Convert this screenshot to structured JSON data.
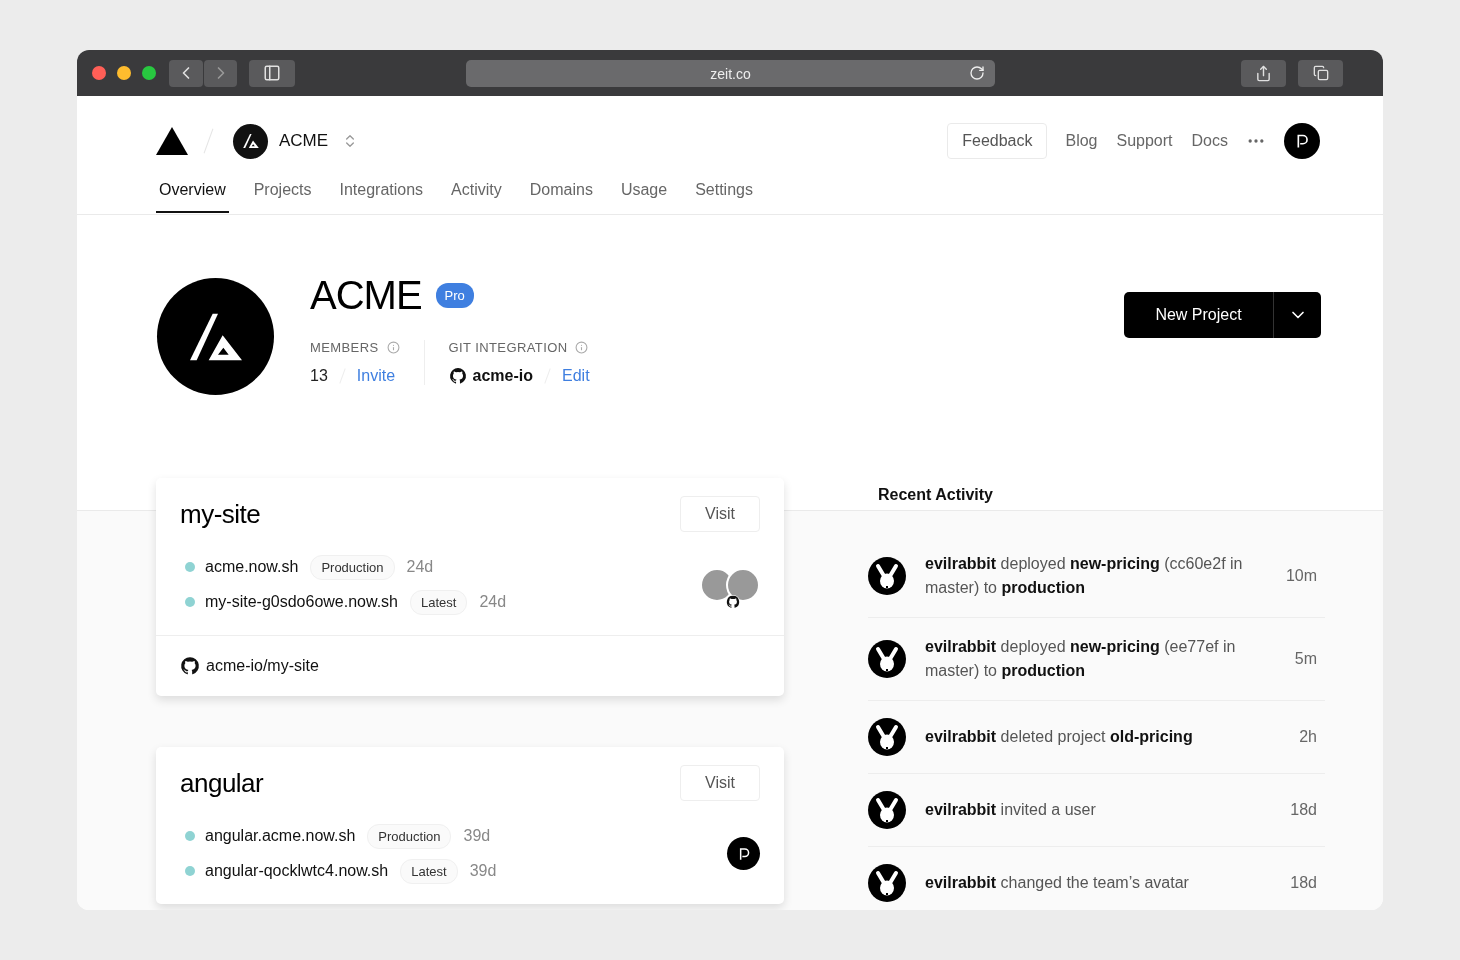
{
  "browser": {
    "url": "zeit.co"
  },
  "header": {
    "team": "ACME",
    "feedback": "Feedback",
    "links": [
      "Blog",
      "Support",
      "Docs"
    ]
  },
  "tabs": [
    {
      "label": "Overview",
      "selected": true
    },
    {
      "label": "Projects",
      "selected": false
    },
    {
      "label": "Integrations",
      "selected": false
    },
    {
      "label": "Activity",
      "selected": false
    },
    {
      "label": "Domains",
      "selected": false
    },
    {
      "label": "Usage",
      "selected": false
    },
    {
      "label": "Settings",
      "selected": false
    }
  ],
  "team": {
    "name": "ACME",
    "plan": "Pro",
    "members_label": "MEMBERS",
    "members_count": "13",
    "invite": "Invite",
    "git_label": "GIT INTEGRATION",
    "git_account": "acme-io",
    "edit": "Edit"
  },
  "new_project": "New Project",
  "projects": [
    {
      "name": "my-site",
      "visit": "Visit",
      "kind": "photos",
      "repo": "acme-io/my-site",
      "deployments": [
        {
          "url": "acme.now.sh",
          "tag": "Production",
          "age": "24d"
        },
        {
          "url": "my-site-g0sdo6owe.now.sh",
          "tag": "Latest",
          "age": "24d"
        }
      ]
    },
    {
      "name": "angular",
      "visit": "Visit",
      "kind": "logo",
      "deployments": [
        {
          "url": "angular.acme.now.sh",
          "tag": "Production",
          "age": "39d"
        },
        {
          "url": "angular-qocklwtc4.now.sh",
          "tag": "Latest",
          "age": "39d"
        }
      ]
    }
  ],
  "activity": {
    "title": "Recent Activity",
    "items": [
      {
        "text": "**evilrabbit** deployed **new-pricing** (cc60e2f in master) to **production**",
        "time": "10m"
      },
      {
        "text": "**evilrabbit** deployed **new-pricing** (ee77ef in master) to **production**",
        "time": "5m"
      },
      {
        "text": "**evilrabbit** deleted project **old-pricing**",
        "time": "2h"
      },
      {
        "text": "**evilrabbit** invited a user",
        "time": "18d"
      },
      {
        "text": "**evilrabbit** changed the team’s avatar",
        "time": "18d"
      }
    ]
  }
}
